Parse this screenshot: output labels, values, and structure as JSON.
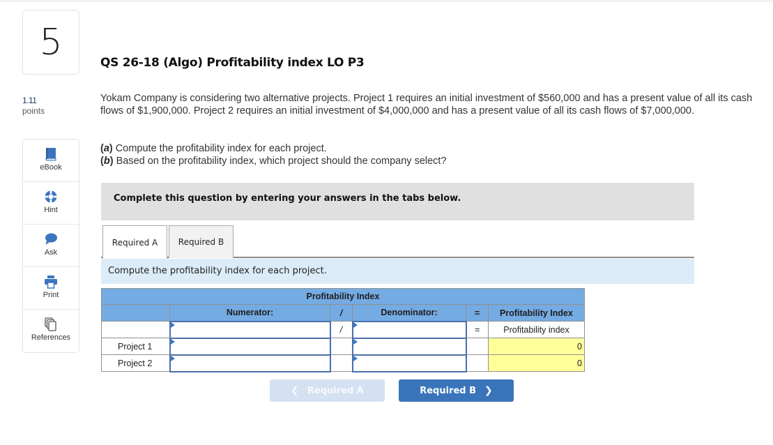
{
  "question": {
    "number": "5",
    "points_value": "1.11",
    "points_label": "points",
    "title": "QS 26-18 (Algo) Profitability index LO P3",
    "prompt": "Yokam Company is considering two alternative projects. Project 1 requires an initial investment of $560,000 and has a present value of all its cash flows of $1,900,000. Project 2 requires an initial investment of $4,000,000 and has a present value of all its cash flows of $7,000,000.",
    "parts": [
      {
        "tag": "a",
        "text": "Compute the profitability index for each project."
      },
      {
        "tag": "b",
        "text": "Based on the profitability index, which project should the company select?"
      }
    ]
  },
  "sidebar": {
    "tools": [
      {
        "label": "eBook",
        "icon": "book-icon"
      },
      {
        "label": "Hint",
        "icon": "lifebuoy-icon"
      },
      {
        "label": "Ask",
        "icon": "speech-bubble-icon"
      },
      {
        "label": "Print",
        "icon": "printer-icon"
      },
      {
        "label": "References",
        "icon": "documents-icon"
      }
    ]
  },
  "banner": "Complete this question by entering your answers in the tabs below.",
  "tabs": [
    {
      "label": "Required A",
      "active": true
    },
    {
      "label": "Required B",
      "active": false
    }
  ],
  "instruction": "Compute the profitability index for each project.",
  "table": {
    "title": "Profitability Index",
    "headers": {
      "numerator": "Numerator:",
      "divide": "/",
      "denominator": "Denominator:",
      "equals": "=",
      "result": "Profitability Index"
    },
    "label_row": {
      "numerator_value": "",
      "divide": "/",
      "denominator_value": "",
      "equals": "=",
      "result": "Profitability index"
    },
    "rows": [
      {
        "label": "Project 1",
        "numerator": "",
        "denominator": "",
        "result": "0"
      },
      {
        "label": "Project 2",
        "numerator": "",
        "denominator": "",
        "result": "0"
      }
    ]
  },
  "nav": {
    "prev_label": "Required A",
    "next_label": "Required B",
    "prev_enabled": false,
    "next_enabled": true
  },
  "colors": {
    "accent_blue": "#3a75bb",
    "header_blue": "#75abe3",
    "result_yellow": "#ffff99",
    "instruction_bg": "#dbecf8",
    "banner_bg": "#e0e0e0"
  }
}
